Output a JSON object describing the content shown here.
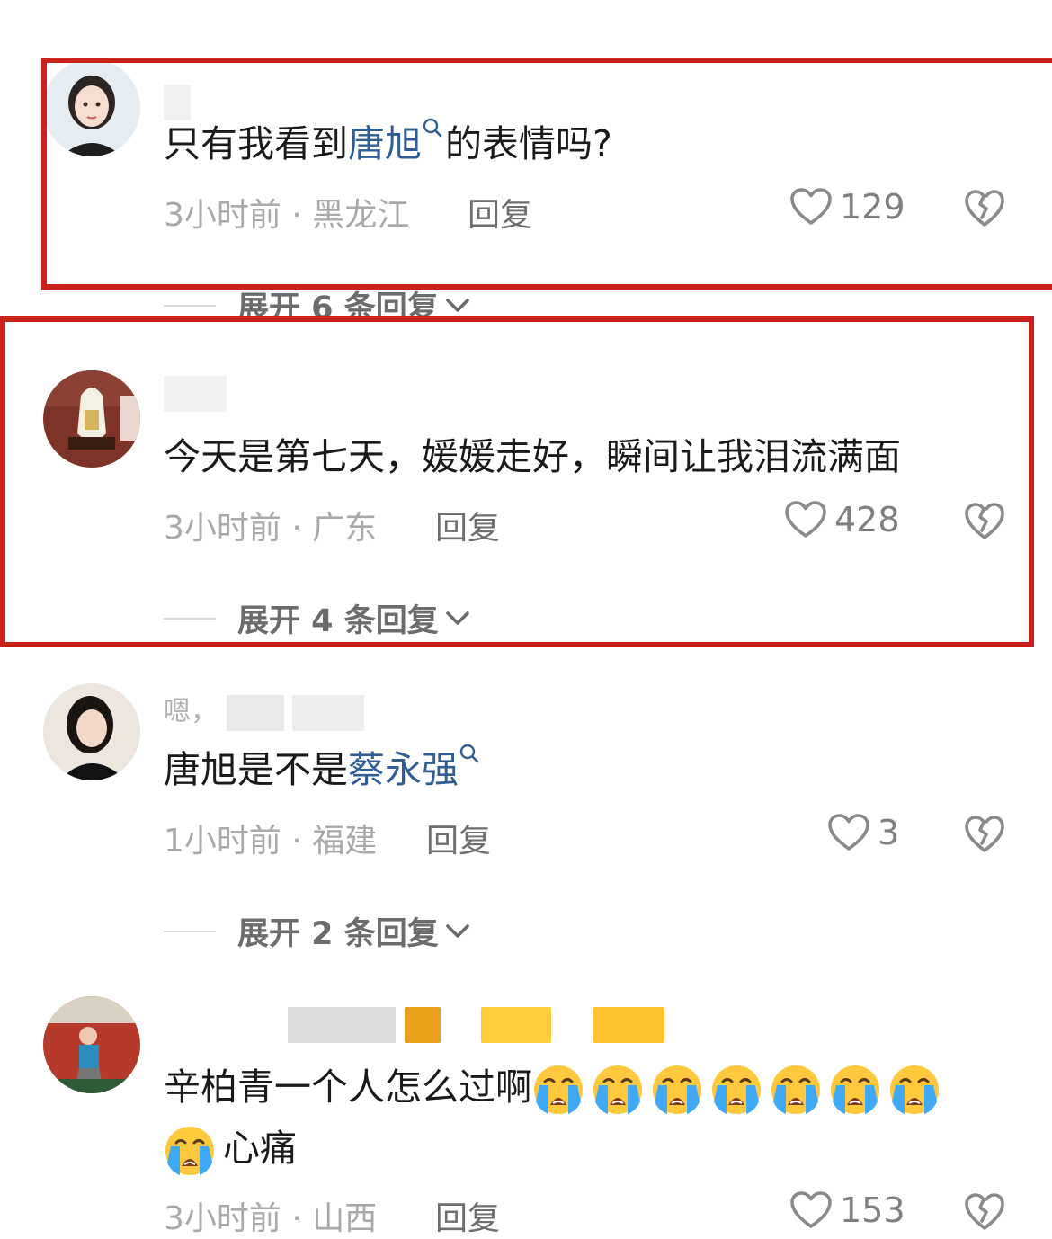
{
  "comments": [
    {
      "prefix": "只有我看到",
      "link": "唐旭",
      "suffix": "的表情吗?",
      "meta": "3小时前 · 黑龙江",
      "reply": "回复",
      "likes": "129",
      "expand": "展开 6 条回复"
    },
    {
      "text": "今天是第七天，媛媛走好，瞬间让我泪流满面",
      "meta": "3小时前 · 广东",
      "reply": "回复",
      "likes": "428",
      "expand": "展开 4 条回复"
    },
    {
      "username_visible": "嗯，",
      "prefix": "唐旭是不是",
      "link": "蔡永强",
      "meta": "1小时前 · 福建",
      "reply": "回复",
      "likes": "3",
      "expand": "展开 2 条回复"
    },
    {
      "text": "辛柏青一个人怎么过啊",
      "text2": "心痛",
      "meta": "3小时前 · 山西",
      "reply": "回复",
      "likes": "153"
    }
  ],
  "icons": {
    "like": "heart-outline-icon",
    "dislike": "broken-heart-icon",
    "expand": "chevron-down-icon",
    "link_search": "search-icon",
    "emoji": "loudly-crying-face-emoji"
  },
  "colors": {
    "highlight_border": "#c9231c",
    "link": "#2f5d94"
  }
}
